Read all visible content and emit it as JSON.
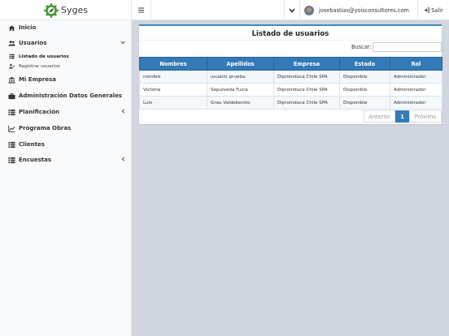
{
  "brand": {
    "name": "Syges",
    "icon": "gear-leaf-logo"
  },
  "topbar": {
    "menu_icon": "hamburger-icon",
    "dropdown_icon": "chevron-down-icon",
    "user_email": "josebastias@yoisconsultores.com",
    "logout_label": "Salir"
  },
  "sidebar": {
    "items": [
      {
        "label": "Inicio",
        "icon": "home-icon"
      },
      {
        "label": "Usuarios",
        "icon": "users-icon",
        "expanded": true
      },
      {
        "label": "Listado de usuarios",
        "icon": "list-icon"
      },
      {
        "label": "Registrar usuarios",
        "icon": "user-plus-icon"
      },
      {
        "label": "Mi Empresa",
        "icon": "bank-icon"
      },
      {
        "label": "Administración Datos Generales",
        "icon": "briefcase-icon"
      },
      {
        "label": "Planificación",
        "icon": "list-icon"
      },
      {
        "label": "Programa Obras",
        "icon": "chart-icon"
      },
      {
        "label": "Clientes",
        "icon": "list-icon"
      },
      {
        "label": "Encuestas",
        "icon": "list-icon"
      }
    ]
  },
  "main": {
    "title": "Listado de usuarios",
    "search_label": "Buscar:",
    "search_value": "",
    "table": {
      "headers": [
        "Nombres",
        "Apellidos",
        "Empresa",
        "Estado",
        "Rol"
      ],
      "rows": [
        [
          "nombre",
          "usuario prueba",
          "Diproinduca Chile SPA",
          "Disponible",
          "Administrador"
        ],
        [
          "Victoria",
          "Sepulveda Fuica",
          "Diproinduca Chile SPA",
          "Disponible",
          "Administrador"
        ],
        [
          "Luis",
          "Grau Valdebenito",
          "Diproinduca Chile SPA",
          "Disponible",
          "Administrador"
        ]
      ]
    },
    "pagination": {
      "prev": "Anterior",
      "current": "1",
      "next": "Próximo"
    }
  },
  "colors": {
    "accent": "#337ab7",
    "brand_green": "#3a8a3a",
    "content_bg": "#d2d6de",
    "sidebar_bg": "#f9fafc"
  }
}
